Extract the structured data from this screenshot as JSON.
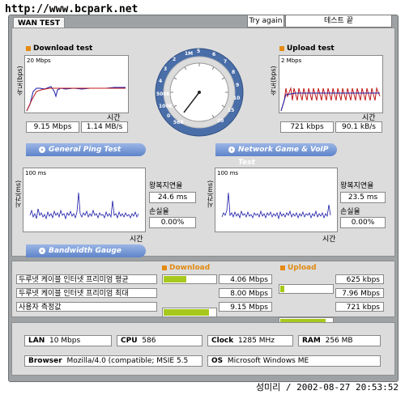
{
  "url": "http://www.bcpark.net",
  "tabs": {
    "wan": "WAN TEST"
  },
  "header": {
    "try_again": "Try again",
    "status": "테스트 끝"
  },
  "download": {
    "title": "Download test",
    "ylabel": "속도(bps)",
    "scale": "20 Mbps",
    "xlabel": "시간",
    "value_bps": "9.15 Mbps",
    "value_bytes": "1.14 MB/s"
  },
  "upload": {
    "title": "Upload test",
    "ylabel": "속도(bps)",
    "scale": "2 Mbps",
    "xlabel": "시간",
    "value_bps": "721 kbps",
    "value_bytes": "90.1 kB/s"
  },
  "gauge": {
    "label_5": "5",
    "label_6": "6",
    "label_7": "7",
    "label_8": "8",
    "label_9": "9",
    "label_10": "10",
    "label_15": "15",
    "label_20": "20",
    "label_1m": "1M",
    "label_2": "2",
    "label_3": "3",
    "label_4": "4",
    "label_500k": "500K",
    "label_100k": "100K",
    "label_0": "0",
    "label_56k": "56K"
  },
  "ping": {
    "banner": "General Ping Test",
    "ylabel": "시간(ms)",
    "scale": "100 ms",
    "xlabel": "시간",
    "rtt_label": "왕복지연율",
    "rtt_value": "24.6 ms",
    "loss_label": "손실율",
    "loss_value": "0.00%"
  },
  "game": {
    "banner": "Network Game & VoIP Test",
    "ylabel": "시간(ms)",
    "scale": "100 ms",
    "xlabel": "시간",
    "rtt_label": "왕복지연율",
    "rtt_value": "23.5 ms",
    "loss_label": "손실율",
    "loss_value": "0.00%"
  },
  "bandwidth": {
    "banner": "Bandwidth Gauge",
    "download_header": "Download",
    "upload_header": "Upload",
    "rows": [
      {
        "name": "두루넷 케이블 인터넷 프리미엄 평균",
        "download": "4.06 Mbps",
        "download_frac": 0.44,
        "upload": "625 kbps",
        "upload_frac": 0.08
      },
      {
        "name": "두루넷 케이블 인터넷 프리미엄 최대",
        "download": "8.00 Mbps",
        "download_frac": 0.87,
        "upload": "7.96 Mbps",
        "upload_frac": 0.88
      },
      {
        "name": "사용자 측정값",
        "download": "9.15 Mbps",
        "download_frac": 1.0,
        "upload": "721 kbps",
        "upload_frac": 0.09
      }
    ]
  },
  "system": {
    "lan_label": "LAN",
    "lan_value": "10 Mbps",
    "cpu_label": "CPU",
    "cpu_value": "586",
    "clock_label": "Clock",
    "clock_value": "1285 MHz",
    "ram_label": "RAM",
    "ram_value": "256 MB",
    "browser_label": "Browser",
    "browser_value": "Mozilla/4.0 (compatible; MSIE 5.5",
    "os_label": "OS",
    "os_value": "Microsoft Windows ME"
  },
  "footer": "성미리 / 2002-08-27 20:53:52"
}
